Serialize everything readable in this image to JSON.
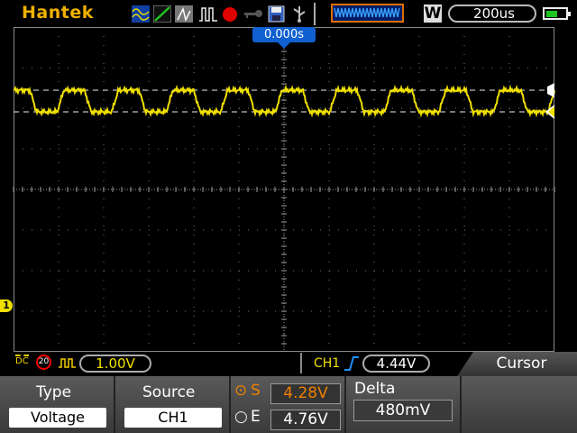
{
  "topbar": {
    "brand": "Hantek",
    "mode_badge": "W",
    "timebase": "200us",
    "icons": [
      "waveform-icon",
      "line-icon",
      "persistence-icon",
      "pulse-icon",
      "record-icon",
      "key-icon",
      "save-icon",
      "usb-icon"
    ]
  },
  "trigger": {
    "position": "0.000s",
    "source": "CH1",
    "level": "4.44V"
  },
  "channel": {
    "marker": "1",
    "coupling": "DC",
    "bw_limit": "20",
    "volts_div": "1.00V"
  },
  "menu": {
    "title": "Cursor",
    "type_label": "Type",
    "type_value": "Voltage",
    "source_label": "Source",
    "source_value": "CH1",
    "s_label": "S",
    "s_value": "4.28V",
    "e_label": "E",
    "e_value": "4.76V",
    "delta_label": "Delta",
    "delta_value": "480mV"
  },
  "colors": {
    "ch1": "#f0e000",
    "brand": "#f0b000",
    "accent": "#1060d0",
    "cursor_active": "#f08000"
  }
}
